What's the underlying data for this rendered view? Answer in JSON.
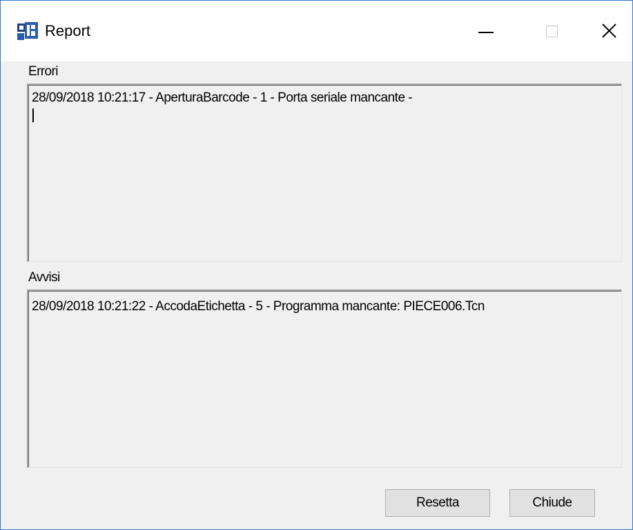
{
  "window": {
    "title": "Report"
  },
  "errori": {
    "label": "Errori",
    "lines": [
      "28/09/2018 10:21:17 - AperturaBarcode - 1 - Porta seriale mancante -"
    ]
  },
  "avvisi": {
    "label": "Avvisi",
    "lines": [
      "28/09/2018 10:21:22 - AccodaEtichetta - 5 - Programma mancante: PIECE006.Tcn"
    ]
  },
  "buttons": {
    "resetta": "Resetta",
    "chiude": "Chiude"
  },
  "icons": {
    "app": "app-icon",
    "minimize": "minimize-icon",
    "maximize": "maximize-icon",
    "close": "close-icon"
  },
  "colors": {
    "window_border": "#2b79d3",
    "window_bg": "#f0f0f0",
    "button_bg": "#e1e1e1"
  }
}
